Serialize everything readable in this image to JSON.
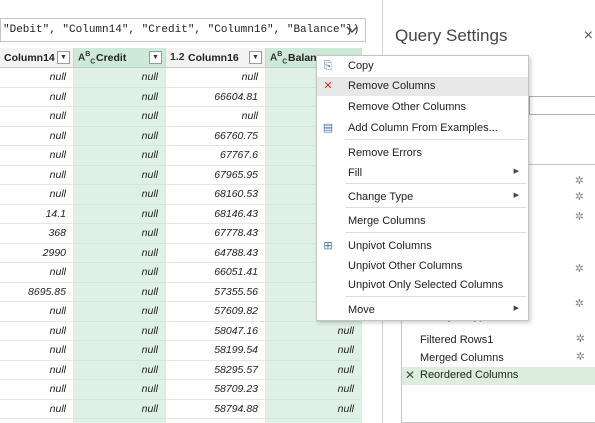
{
  "formula": {
    "text": "\"Debit\", \"Column14\", \"Credit\", \"Column16\", \"Balance\"})",
    "expand_icon": "chevron-down-icon"
  },
  "grid": {
    "columns": [
      {
        "name": "Column14",
        "type_icon": ""
      },
      {
        "name": "Credit",
        "type_icon": "ABC"
      },
      {
        "name": "Column16",
        "type_icon": "1.2"
      },
      {
        "name": "Balance",
        "type_icon": "ABC"
      }
    ],
    "filter_icon": "▼",
    "column14": [
      "null",
      "null",
      "null",
      "null",
      "null",
      "null",
      "null",
      "14.1",
      "368",
      "2990",
      "null",
      "8695.85",
      "null",
      "null",
      "null",
      "null",
      "null",
      "null",
      "null"
    ],
    "credit": [
      "null",
      "null",
      "null",
      "null",
      "null",
      "null",
      "null",
      "null",
      "null",
      "null",
      "null",
      "null",
      "null",
      "null",
      "null",
      "null",
      "null",
      "null",
      "null"
    ],
    "column16": [
      "null",
      "66604.81",
      "null",
      "66760.75",
      "67767.6",
      "67965.95",
      "68160.53",
      "68146.43",
      "67778.43",
      "64788.43",
      "66051.41",
      "57355.56",
      "57609.82",
      "58047.16",
      "58199.54",
      "58295.57",
      "58709.23",
      "58794.88",
      "59376.67"
    ],
    "balance_visible": {
      "13": "null",
      "14": "null",
      "15": "null",
      "16": "null",
      "17": "null",
      "18": "null"
    }
  },
  "context_menu": {
    "items": [
      {
        "label": "Copy",
        "icon": "copy-icon",
        "glyph": "⎘",
        "has_submenu": false,
        "hover": false
      },
      {
        "label": "Remove Columns",
        "icon": "remove-columns-icon",
        "glyph": "✕",
        "has_submenu": false,
        "hover": true
      },
      {
        "label": "Remove Other Columns",
        "icon": "",
        "glyph": "",
        "has_submenu": false,
        "hover": false
      },
      {
        "label": "Add Column From Examples...",
        "icon": "add-column-examples-icon",
        "glyph": "▤",
        "has_submenu": false,
        "hover": false
      },
      {
        "label": "Remove Errors",
        "icon": "",
        "glyph": "",
        "has_submenu": false,
        "hover": false
      },
      {
        "label": "Fill",
        "icon": "",
        "glyph": "",
        "has_submenu": true,
        "hover": false
      },
      {
        "label": "Change Type",
        "icon": "",
        "glyph": "",
        "has_submenu": true,
        "hover": false
      },
      {
        "label": "Merge Columns",
        "icon": "",
        "glyph": "",
        "has_submenu": false,
        "hover": false
      },
      {
        "label": "Unpivot Columns",
        "icon": "unpivot-icon",
        "glyph": "⊞",
        "has_submenu": false,
        "hover": false
      },
      {
        "label": "Unpivot Other Columns",
        "icon": "",
        "glyph": "",
        "has_submenu": false,
        "hover": false
      },
      {
        "label": "Unpivot Only Selected Columns",
        "icon": "",
        "glyph": "",
        "has_submenu": false,
        "hover": false
      },
      {
        "label": "Move",
        "icon": "",
        "glyph": "",
        "has_submenu": true,
        "hover": false
      }
    ],
    "submenu_arrow": "▶",
    "colors": {
      "remove_icon": "#d9342b",
      "hover_bg": "#e8e8e8"
    }
  },
  "query_settings": {
    "title": "Query Settings",
    "close_glyph": "×",
    "steps": [
      {
        "label": "Changed Type1",
        "deletable": false,
        "gear": false,
        "active": false
      },
      {
        "label": "Filtered Rows1",
        "deletable": false,
        "gear": true,
        "active": false
      },
      {
        "label": "Merged Columns",
        "deletable": false,
        "gear": true,
        "active": false
      },
      {
        "label": "Reordered Columns",
        "deletable": true,
        "gear": false,
        "active": true
      }
    ],
    "hidden_step_gears": 5,
    "gear_glyph": "✲",
    "delete_glyph": "✕",
    "colors": {
      "active_step": "#ddeedd"
    }
  }
}
